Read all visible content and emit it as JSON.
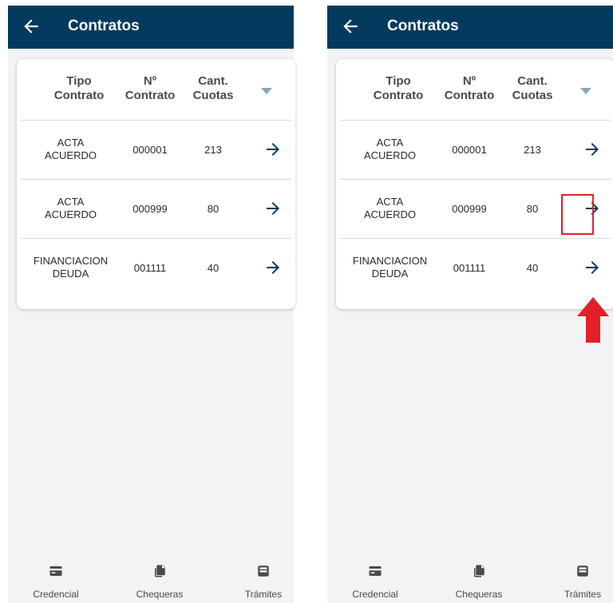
{
  "screens": [
    {
      "app_bar": {
        "title": "Contratos",
        "back_icon": "arrow-left-icon"
      },
      "table": {
        "headers": {
          "tipo": "Tipo\nContrato",
          "numero": "Nº\nContrato",
          "cuotas": "Cant.\nCuotas"
        },
        "sort_icon": "triangle-down-icon",
        "rows": [
          {
            "tipo": "ACTA\nACUERDO",
            "numero": "000001",
            "cuotas": "213",
            "action_icon": "arrow-right-icon"
          },
          {
            "tipo": "ACTA\nACUERDO",
            "numero": "000999",
            "cuotas": "80",
            "action_icon": "arrow-right-icon"
          },
          {
            "tipo": "FINANCIACION\nDEUDA",
            "numero": "001111",
            "cuotas": "40",
            "action_icon": "arrow-right-icon"
          }
        ]
      },
      "bottom_nav": [
        {
          "label": "Credencial",
          "icon": "card-icon"
        },
        {
          "label": "Chequeras",
          "icon": "documents-icon"
        },
        {
          "label": "Trámites",
          "icon": "inbox-icon"
        }
      ]
    },
    {
      "app_bar": {
        "title": "Contratos",
        "back_icon": "arrow-left-icon"
      },
      "table": {
        "headers": {
          "tipo": "Tipo\nContrato",
          "numero": "Nº\nContrato",
          "cuotas": "Cant.\nCuotas"
        },
        "sort_icon": "triangle-down-icon",
        "rows": [
          {
            "tipo": "ACTA\nACUERDO",
            "numero": "000001",
            "cuotas": "213",
            "action_icon": "arrow-right-icon"
          },
          {
            "tipo": "ACTA\nACUERDO",
            "numero": "000999",
            "cuotas": "80",
            "action_icon": "arrow-right-icon"
          },
          {
            "tipo": "FINANCIACION\nDEUDA",
            "numero": "001111",
            "cuotas": "40",
            "action_icon": "arrow-right-icon"
          }
        ]
      },
      "annotation": {
        "highlighted_row": 3,
        "highlight_color": "#e3202a",
        "pointer_icon": "red-up-arrow-icon"
      },
      "bottom_nav": [
        {
          "label": "Credencial",
          "icon": "card-icon"
        },
        {
          "label": "Chequeras",
          "icon": "documents-icon"
        },
        {
          "label": "Trámites",
          "icon": "inbox-icon"
        }
      ]
    }
  ],
  "colors": {
    "app_bar": "#053a5f",
    "accent": "#053a5f",
    "background": "#f2f3f5",
    "annotation_red": "#e3202a"
  }
}
